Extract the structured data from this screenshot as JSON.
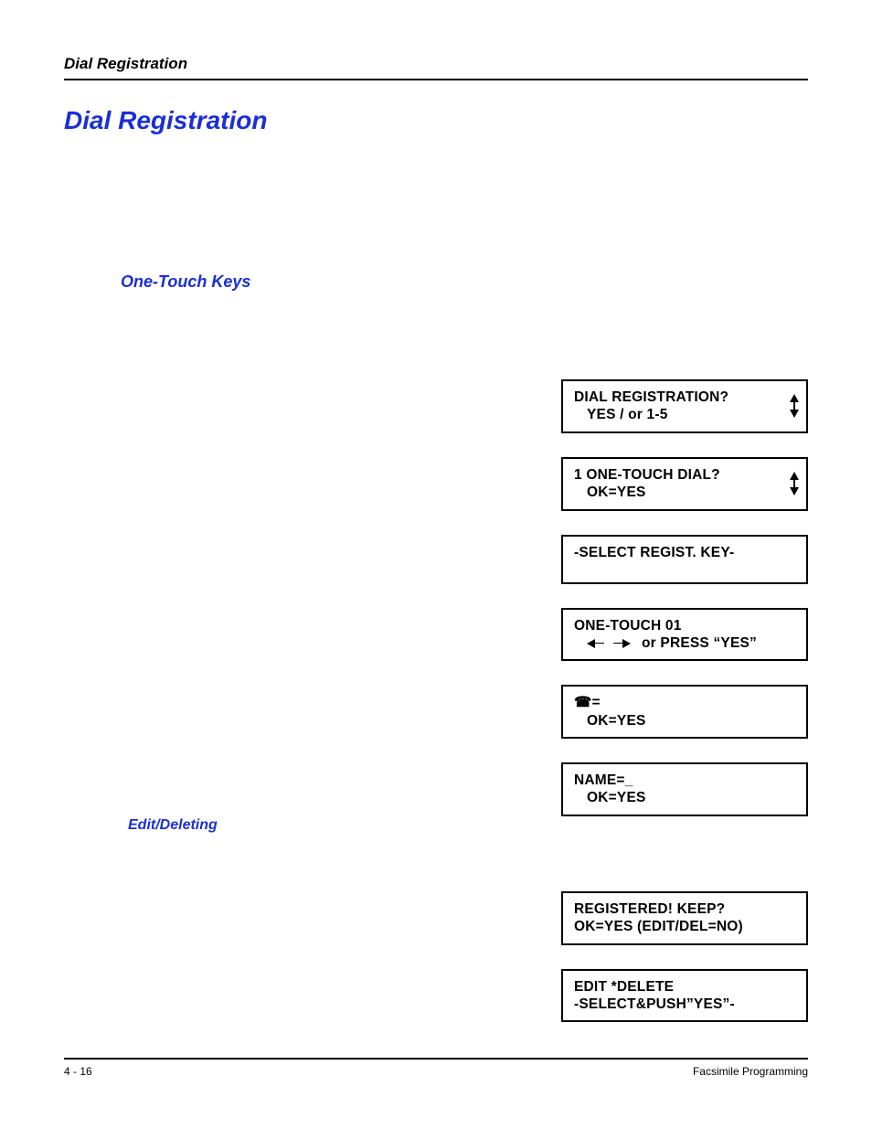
{
  "header": {
    "running_title": "Dial Registration"
  },
  "h1": "Dial Registration",
  "h2": "One-Touch Keys",
  "h3": "Edit/Deleting",
  "lcd": {
    "dial_reg": {
      "line1": "DIAL REGISTRATION?",
      "line2": "YES / or 1-5"
    },
    "one_touch_dial": {
      "line1": "1 ONE-TOUCH DIAL?",
      "line2": "OK=YES"
    },
    "select_regist": {
      "line1": "-SELECT REGIST. KEY-"
    },
    "one_touch_01": {
      "line1": "ONE-TOUCH  01",
      "line2": "or PRESS “YES”"
    },
    "phone_entry": {
      "line1": "☎=",
      "line2": "OK=YES"
    },
    "name_entry": {
      "line1": "NAME=_",
      "line2": "OK=YES"
    },
    "registered_keep": {
      "line1": "REGISTERED!    KEEP?",
      "line2": "OK=YES (EDIT/DEL=NO)"
    },
    "edit_delete": {
      "line1": "EDIT             *DELETE",
      "line2": "-SELECT&PUSH”YES”-"
    }
  },
  "footer": {
    "left": "4 - 16",
    "right": "Facsimile Programming"
  }
}
